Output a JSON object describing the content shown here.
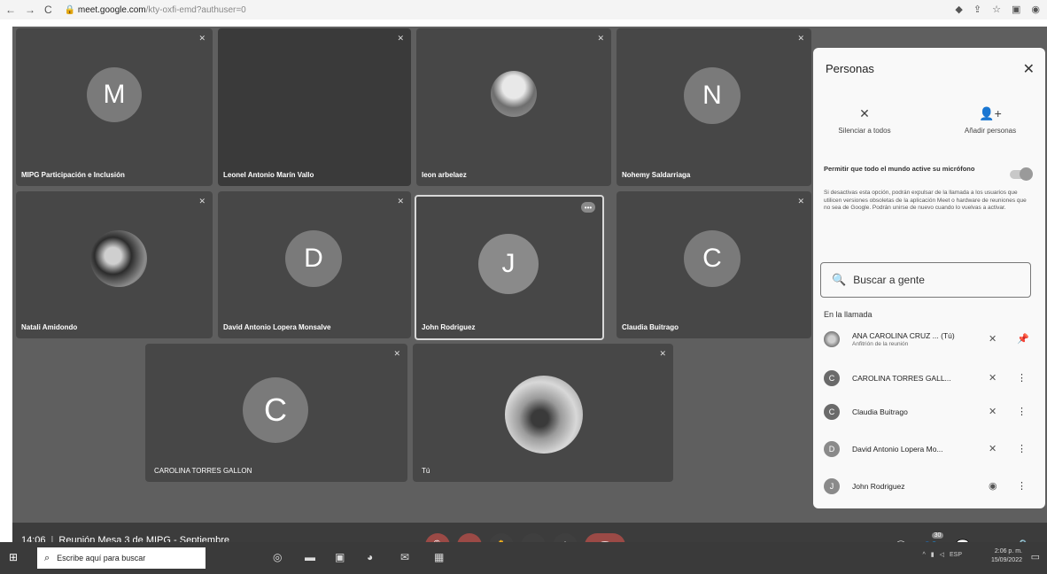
{
  "browser": {
    "back": "←",
    "forward": "→",
    "reload": "C",
    "url_host": "meet.google.com",
    "url_path": "/kty-oxfi-emd?authuser=0",
    "icons": [
      "extension-icon",
      "share-icon",
      "star-icon",
      "sidepanel-icon",
      "profile-icon"
    ]
  },
  "tiles": [
    {
      "name": "MIPG Participación e Inclusión",
      "initial": "M",
      "type": "initial"
    },
    {
      "name": "Leonel Antonio Marín Vallo",
      "initial": "",
      "type": "blank"
    },
    {
      "name": "leon arbelaez",
      "initial": "",
      "type": "photo"
    },
    {
      "name": "Nohemy Saldarriaga",
      "initial": "N",
      "type": "initial"
    },
    {
      "name": "Natali Amidondo",
      "initial": "",
      "type": "photo"
    },
    {
      "name": "David Antonio Lopera Monsalve",
      "initial": "D",
      "type": "initial"
    },
    {
      "name": "John Rodriguez",
      "initial": "J",
      "type": "initial",
      "more": "•••"
    },
    {
      "name": "Claudia Buitrago",
      "initial": "C",
      "type": "initial"
    },
    {
      "name": "CAROLINA TORRES GALLON",
      "initial": "C",
      "type": "initial"
    },
    {
      "name": "Tú",
      "initial": "",
      "type": "photo"
    }
  ],
  "meeting": {
    "time": "14:06",
    "title": "Reunión Mesa 3 de MIPG - Septiembre"
  },
  "controls": {
    "mic": "🎙",
    "camera": "◘",
    "hand": "✋",
    "present": "⬒",
    "more": "⋮",
    "hangup": "☎",
    "info": "ⓘ",
    "people": "👥",
    "people_count": "30",
    "chat": "💬",
    "activities": "△",
    "lock": "🔒"
  },
  "panel": {
    "title": "Personas",
    "close": "✕",
    "mute_all": "Silenciar a todos",
    "add_people": "Añadir personas",
    "permission_title": "Permitir que todo el mundo active su micrófono",
    "permission_desc": "Si desactivas esta opción, podrán expulsar de la llamada a los usuarios que utilicen versiones obsoletas de la aplicación Meet o hardware de reuniones que no sea de Google. Podrán unirse de nuevo cuando lo vuelvas a activar.",
    "search_placeholder": "Buscar a gente",
    "in_call": "En la llamada",
    "participants": [
      {
        "name": "ANA CAROLINA CRUZ ...  (Tú)",
        "sub": "Anfitrión de la reunión",
        "initial": "",
        "action": "📌"
      },
      {
        "name": "CAROLINA TORRES GALL...",
        "sub": "",
        "initial": "C",
        "action": "⋮"
      },
      {
        "name": "Claudia Buitrago",
        "sub": "",
        "initial": "C",
        "action": "⋮"
      },
      {
        "name": "David Antonio Lopera Mo...",
        "sub": "",
        "initial": "D",
        "action": "⋮"
      },
      {
        "name": "John Rodriguez",
        "sub": "",
        "initial": "J",
        "action": "⋮"
      }
    ]
  },
  "taskbar": {
    "search_placeholder": "Escribe aquí para buscar",
    "language": "ESP",
    "time": "2:06 p. m.",
    "date": "15/09/2022"
  },
  "colors": {
    "meet_bg": "#5f5f5f",
    "tile_bg": "#474747",
    "avatar": "#7a7a7a",
    "hangup": "#9b4a46"
  }
}
